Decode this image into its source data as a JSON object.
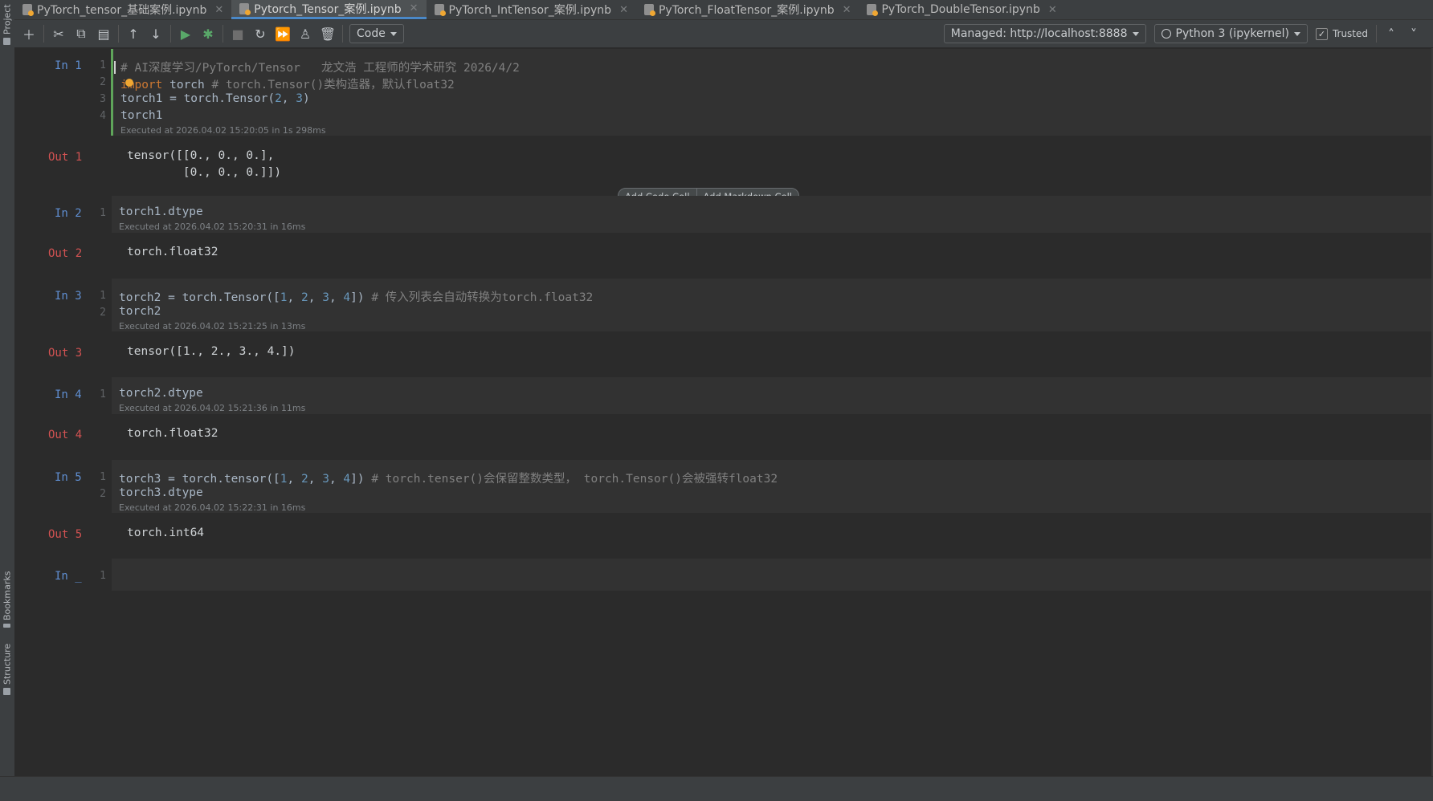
{
  "side_strip": {
    "top_label": "Project",
    "bottom_labels": [
      "Bookmarks",
      "Structure"
    ]
  },
  "tabs": [
    {
      "label": "PyTorch_tensor_基础案例.ipynb",
      "active": false
    },
    {
      "label": "Pytorch_Tensor_案例.ipynb",
      "active": true
    },
    {
      "label": "PyTorch_IntTensor_案例.ipynb",
      "active": false
    },
    {
      "label": "PyTorch_FloatTensor_案例.ipynb",
      "active": false
    },
    {
      "label": "PyTorch_DoubleTensor.ipynb",
      "active": false
    }
  ],
  "toolbar": {
    "cell_type": "Code",
    "server": "Managed: http://localhost:8888",
    "kernel": "Python 3 (ipykernel)",
    "trusted_label": "Trusted"
  },
  "add_buttons": {
    "code": "Add Code Cell",
    "markdown": "Add Markdown Cell"
  },
  "cells": [
    {
      "in": "In 1",
      "lines": [
        {
          "n": "1",
          "text": "# AI深度学习/PyTorch/Tensor   龙文浩 工程师的学术研究 2026/4/2"
        },
        {
          "n": "2",
          "text": "import torch # torch.Tensor()类构造器，默认float32"
        },
        {
          "n": "3",
          "text": "torch1 = torch.Tensor(2, 3)"
        },
        {
          "n": "4",
          "text": "torch1"
        }
      ],
      "exec": "Executed at 2026.04.02 15:20:05 in 1s 298ms",
      "out": "Out 1",
      "output": [
        "tensor([[0., 0., 0.],",
        "        [0., 0., 0.]])"
      ]
    },
    {
      "in": "In 2",
      "lines": [
        {
          "n": "1",
          "text": "torch1.dtype"
        }
      ],
      "exec": "Executed at 2026.04.02 15:20:31 in 16ms",
      "out": "Out 2",
      "output": [
        "torch.float32"
      ]
    },
    {
      "in": "In 3",
      "lines": [
        {
          "n": "1",
          "text": "torch2 = torch.Tensor([1, 2, 3, 4]) # 传入列表会自动转换为torch.float32"
        },
        {
          "n": "2",
          "text": "torch2"
        }
      ],
      "exec": "Executed at 2026.04.02 15:21:25 in 13ms",
      "out": "Out 3",
      "output": [
        "tensor([1., 2., 3., 4.])"
      ]
    },
    {
      "in": "In 4",
      "lines": [
        {
          "n": "1",
          "text": "torch2.dtype"
        }
      ],
      "exec": "Executed at 2026.04.02 15:21:36 in 11ms",
      "out": "Out 4",
      "output": [
        "torch.float32"
      ]
    },
    {
      "in": "In 5",
      "lines": [
        {
          "n": "1",
          "text": "torch3 = torch.tensor([1, 2, 3, 4]) # torch.tenser()会保留整数类型， torch.Tensor()会被强转float32"
        },
        {
          "n": "2",
          "text": "torch3.dtype"
        }
      ],
      "exec": "Executed at 2026.04.02 15:22:31 in 16ms",
      "out": "Out 5",
      "output": [
        "torch.int64"
      ]
    },
    {
      "in": "In _",
      "lines": [
        {
          "n": "1",
          "text": ""
        }
      ]
    }
  ],
  "colors": {
    "background": "#2b2b2b",
    "code_cell": "#323232",
    "in_prompt": "#5f8ed1",
    "out_prompt": "#d25252",
    "keyword": "#cc7832",
    "number": "#6897bb",
    "comment": "#808080",
    "selected_bar": "#5fa55a"
  },
  "icons": [
    "add-cell-icon",
    "cut-icon",
    "copy-icon",
    "paste-icon",
    "move-up-icon",
    "move-down-icon",
    "run-cell-icon",
    "debug-icon",
    "stop-icon",
    "restart-icon",
    "run-all-icon",
    "clear-icon",
    "delete-icon"
  ]
}
